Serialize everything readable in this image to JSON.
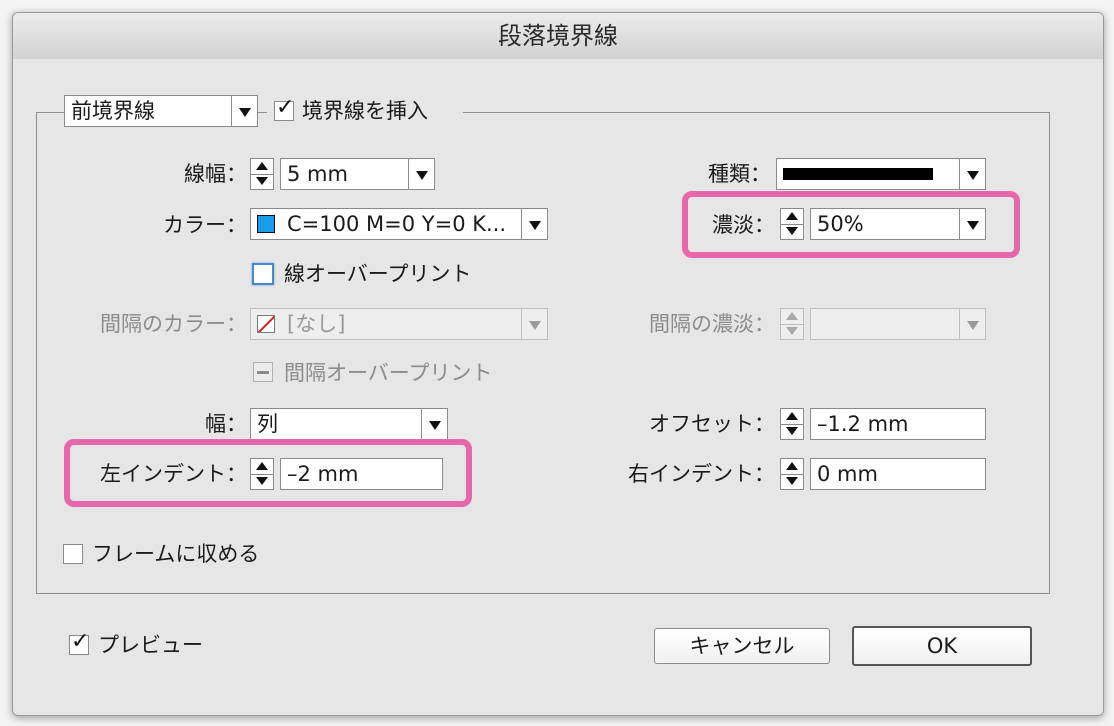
{
  "window": {
    "title": "段落境界線"
  },
  "group": {
    "rule_selector": {
      "value": "前境界線"
    },
    "rule_on": {
      "label": "境界線を挿入",
      "checked": true
    }
  },
  "stroke": {
    "weight": {
      "label": "線幅：",
      "value": "5 mm"
    },
    "type": {
      "label": "種類：",
      "value_icon": "solid-line-icon"
    },
    "color": {
      "label": "カラー：",
      "value": "C=100 M=0 Y=0 K...",
      "swatch_color": "#1a9be8"
    },
    "tint": {
      "label": "濃淡：",
      "value": "50%"
    },
    "overprint": {
      "label": "線オーバープリント",
      "checked": false
    }
  },
  "gap": {
    "color": {
      "label": "間隔のカラー：",
      "value": "[なし]"
    },
    "tint": {
      "label": "間隔の濃淡：",
      "value": ""
    },
    "overprint": {
      "label": "間隔オーバープリント",
      "state": "mixed"
    }
  },
  "layout": {
    "width": {
      "label": "幅：",
      "value": "列"
    },
    "offset": {
      "label": "オフセット：",
      "value": "–1.2 mm"
    },
    "left_indent": {
      "label": "左インデント：",
      "value": "–2 mm"
    },
    "right_indent": {
      "label": "右インデント：",
      "value": "0 mm"
    }
  },
  "keep_in_frame": {
    "label": "フレームに収める",
    "checked": false
  },
  "footer": {
    "preview": {
      "label": "プレビュー",
      "checked": true
    },
    "cancel_label": "キャンセル",
    "ok_label": "OK"
  },
  "colors": {
    "highlight": "#e667aa",
    "cyan_swatch": "#1a9be8",
    "focus_ring": "#4a88c7"
  }
}
